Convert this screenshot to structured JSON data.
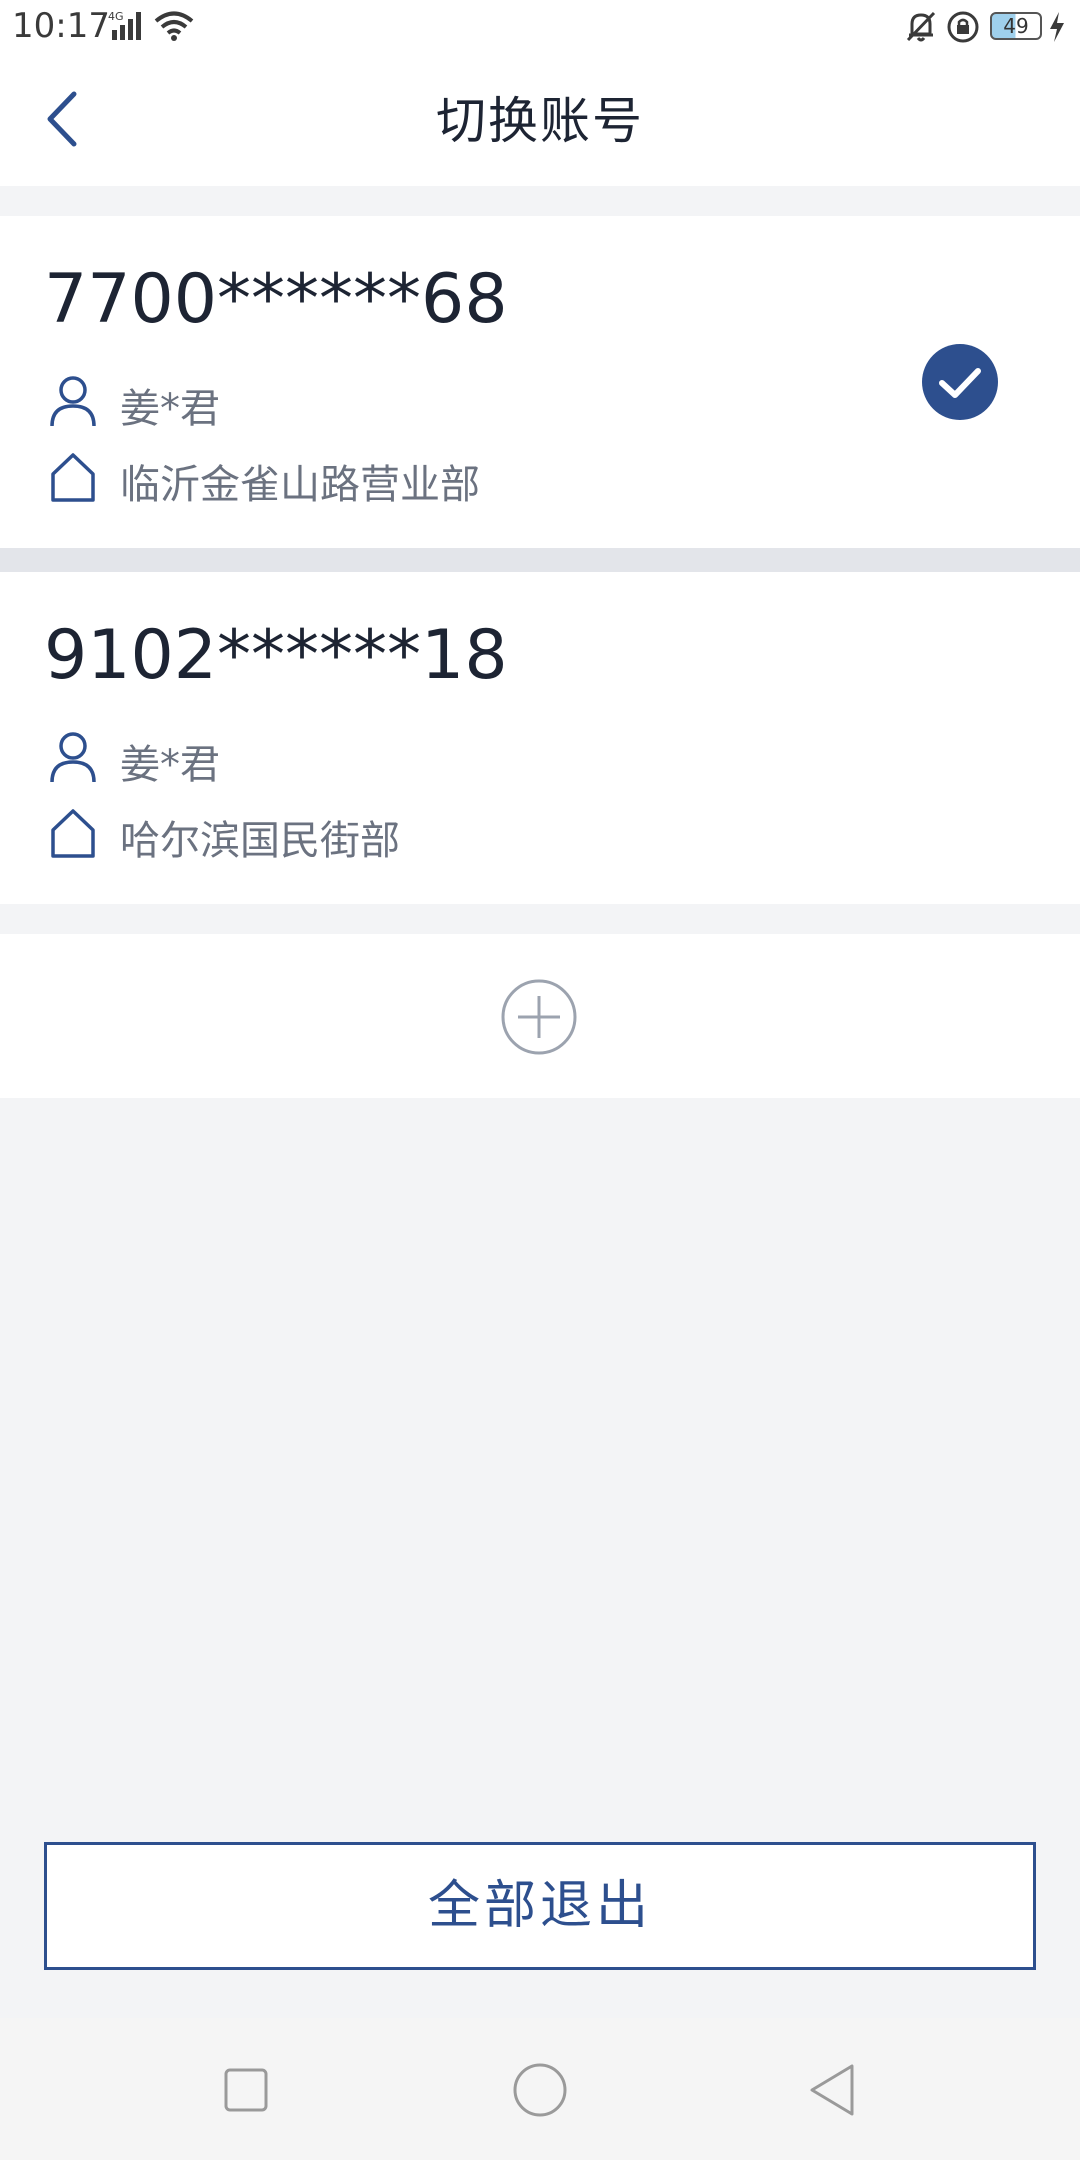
{
  "status_bar": {
    "time": "10:17",
    "network": "4G",
    "battery": "49"
  },
  "nav": {
    "title": "切换账号"
  },
  "accounts": [
    {
      "number": "7700******68",
      "name": "姜*君",
      "branch": "临沂金雀山路营业部",
      "selected": true
    },
    {
      "number": "9102******18",
      "name": "姜*君",
      "branch": "哈尔滨国民街部",
      "selected": false
    }
  ],
  "logout_all_label": "全部退出",
  "icons": {
    "back": "chevron-left-icon",
    "user": "user-icon",
    "branch": "home-icon",
    "selected": "check-circle-icon",
    "add": "plus-circle-icon"
  },
  "colors": {
    "accent": "#2d4f8e",
    "text_primary": "#1d2433",
    "text_secondary": "#6b7280",
    "background": "#f3f4f6"
  }
}
